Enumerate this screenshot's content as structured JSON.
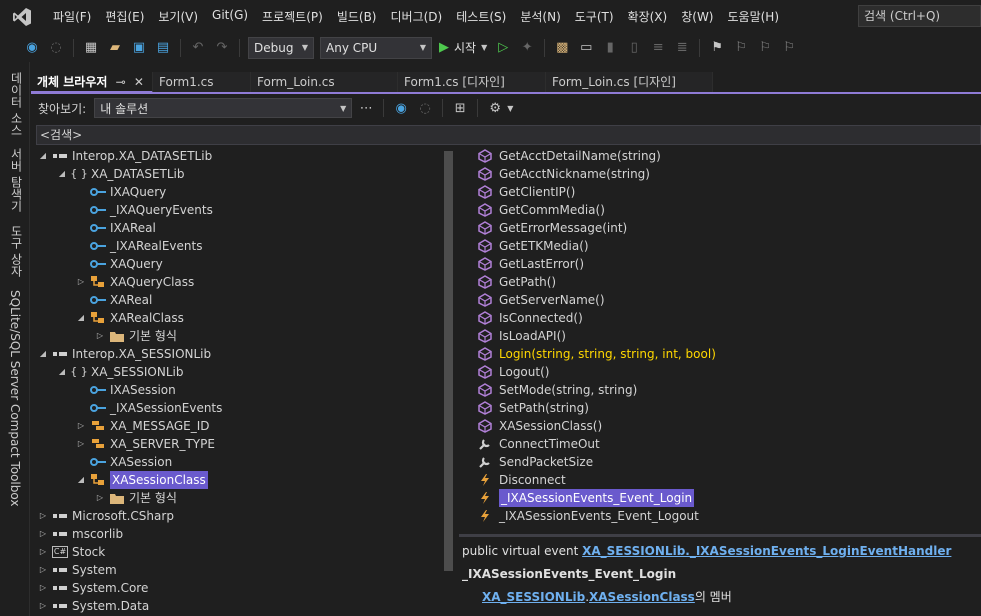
{
  "menu": {
    "items": [
      "파일(F)",
      "편집(E)",
      "보기(V)",
      "Git(G)",
      "프로젝트(P)",
      "빌드(B)",
      "디버그(D)",
      "테스트(S)",
      "분석(N)",
      "도구(T)",
      "확장(X)",
      "창(W)",
      "도움말(H)"
    ],
    "search": "검색 (Ctrl+Q)"
  },
  "toolbar": {
    "config": "Debug",
    "platform": "Any CPU",
    "start": "시작"
  },
  "side_tabs": [
    "데이터 소스",
    "서버 탐색기",
    "도구 상자",
    "SQLite/SQL Server Compact Toolbox"
  ],
  "tabs": [
    {
      "label": "개체 브라우저",
      "active": true
    },
    {
      "label": "Form1.cs",
      "active": false
    },
    {
      "label": "Form_Loin.cs",
      "active": false
    },
    {
      "label": "Form1.cs [디자인]",
      "active": false
    },
    {
      "label": "Form_Loin.cs [디자인]",
      "active": false
    }
  ],
  "object_browser": {
    "browse_label": "찾아보기:",
    "browse_value": "내 솔루션",
    "search_placeholder": "<검색>"
  },
  "tree": [
    {
      "label": "Interop.XA_DATASETLib",
      "indent": 0,
      "expand": "open",
      "icon": "assembly-icon"
    },
    {
      "label": "XA_DATASETLib",
      "indent": 1,
      "expand": "open",
      "icon": "namespace-icon"
    },
    {
      "label": "IXAQuery",
      "indent": 2,
      "expand": "none",
      "icon": "interface-icon"
    },
    {
      "label": "_IXAQueryEvents",
      "indent": 2,
      "expand": "none",
      "icon": "interface-icon"
    },
    {
      "label": "IXAReal",
      "indent": 2,
      "expand": "none",
      "icon": "interface-icon"
    },
    {
      "label": "_IXARealEvents",
      "indent": 2,
      "expand": "none",
      "icon": "interface-icon"
    },
    {
      "label": "XAQuery",
      "indent": 2,
      "expand": "none",
      "icon": "interface-icon"
    },
    {
      "label": "XAQueryClass",
      "indent": 2,
      "expand": "closed",
      "icon": "class-icon"
    },
    {
      "label": "XAReal",
      "indent": 2,
      "expand": "none",
      "icon": "interface-icon"
    },
    {
      "label": "XARealClass",
      "indent": 2,
      "expand": "open",
      "icon": "class-icon"
    },
    {
      "label": "기본 형식",
      "indent": 3,
      "expand": "closed",
      "icon": "folder-icon"
    },
    {
      "label": "Interop.XA_SESSIONLib",
      "indent": 0,
      "expand": "open",
      "icon": "assembly-icon"
    },
    {
      "label": "XA_SESSIONLib",
      "indent": 1,
      "expand": "open",
      "icon": "namespace-icon"
    },
    {
      "label": "IXASession",
      "indent": 2,
      "expand": "none",
      "icon": "interface-icon"
    },
    {
      "label": "_IXASessionEvents",
      "indent": 2,
      "expand": "none",
      "icon": "interface-icon"
    },
    {
      "label": "XA_MESSAGE_ID",
      "indent": 2,
      "expand": "closed",
      "icon": "enum-icon"
    },
    {
      "label": "XA_SERVER_TYPE",
      "indent": 2,
      "expand": "closed",
      "icon": "enum-icon"
    },
    {
      "label": "XASession",
      "indent": 2,
      "expand": "none",
      "icon": "interface-icon"
    },
    {
      "label": "XASessionClass",
      "indent": 2,
      "expand": "open",
      "icon": "class-icon",
      "selected": true
    },
    {
      "label": "기본 형식",
      "indent": 3,
      "expand": "closed",
      "icon": "folder-icon"
    },
    {
      "label": "Microsoft.CSharp",
      "indent": 0,
      "expand": "closed",
      "icon": "assembly-icon"
    },
    {
      "label": "mscorlib",
      "indent": 0,
      "expand": "closed",
      "icon": "assembly-icon"
    },
    {
      "label": "Stock",
      "indent": 0,
      "expand": "closed",
      "icon": "csharp-project-icon"
    },
    {
      "label": "System",
      "indent": 0,
      "expand": "closed",
      "icon": "assembly-icon"
    },
    {
      "label": "System.Core",
      "indent": 0,
      "expand": "closed",
      "icon": "assembly-icon"
    },
    {
      "label": "System.Data",
      "indent": 0,
      "expand": "closed",
      "icon": "assembly-icon"
    }
  ],
  "members": [
    {
      "label": "GetAcctDetailName(string)",
      "icon": "method-icon"
    },
    {
      "label": "GetAcctNickname(string)",
      "icon": "method-icon"
    },
    {
      "label": "GetClientIP()",
      "icon": "method-icon"
    },
    {
      "label": "GetCommMedia()",
      "icon": "method-icon"
    },
    {
      "label": "GetErrorMessage(int)",
      "icon": "method-icon"
    },
    {
      "label": "GetETKMedia()",
      "icon": "method-icon"
    },
    {
      "label": "GetLastError()",
      "icon": "method-icon"
    },
    {
      "label": "GetPath()",
      "icon": "method-icon"
    },
    {
      "label": "GetServerName()",
      "icon": "method-icon"
    },
    {
      "label": "IsConnected()",
      "icon": "method-icon"
    },
    {
      "label": "IsLoadAPI()",
      "icon": "method-icon"
    },
    {
      "label": "Login(string, string, string, int, bool)",
      "icon": "method-icon",
      "highlight": true
    },
    {
      "label": "Logout()",
      "icon": "method-icon"
    },
    {
      "label": "SetMode(string, string)",
      "icon": "method-icon"
    },
    {
      "label": "SetPath(string)",
      "icon": "method-icon"
    },
    {
      "label": "XASessionClass()",
      "icon": "method-icon"
    },
    {
      "label": "ConnectTimeOut",
      "icon": "property-icon"
    },
    {
      "label": "SendPacketSize",
      "icon": "property-icon"
    },
    {
      "label": "Disconnect",
      "icon": "event-icon"
    },
    {
      "label": "_IXASessionEvents_Event_Login",
      "icon": "event-icon",
      "selected": true
    },
    {
      "label": "_IXASessionEvents_Event_Logout",
      "icon": "event-icon"
    }
  ],
  "description": {
    "prefix": "public virtual event ",
    "type_link": "XA_SESSIONLib._IXASessionEvents_LoginEventHandler",
    "name": "_IXASessionEvents_Event_Login",
    "ns_link": "XA_SESSIONLib",
    "dot": ".",
    "class_link": "XASessionClass",
    "suffix": "의 멤버"
  }
}
